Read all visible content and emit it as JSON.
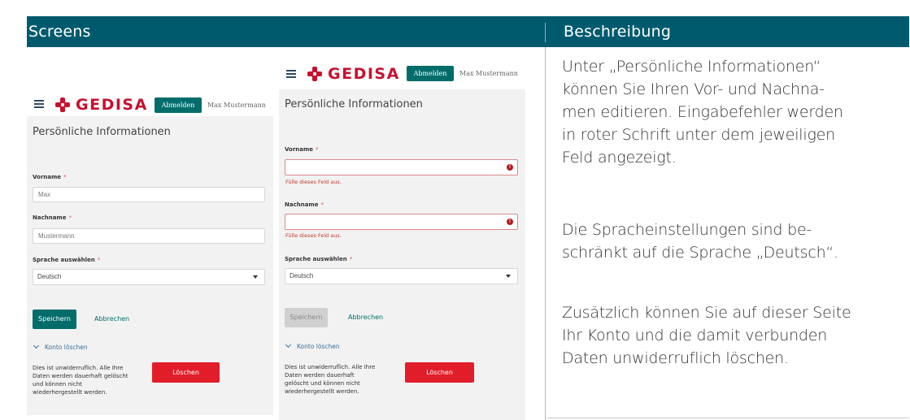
{
  "header": {
    "col_screens": "Screens",
    "col_description": "Beschreibung"
  },
  "screen1": {
    "brand": "GEDISA",
    "logout_label": "Abmelden",
    "user_name": "Max Mustermann",
    "page_title": "Persönliche Informationen",
    "first_name_label": "Vorname",
    "first_name_value": "Max",
    "last_name_label": "Nachname",
    "last_name_value": "Mustermann",
    "language_label": "Sprache auswählen",
    "language_value": "Deutsch",
    "required_mark": "*",
    "save_label": "Speichern",
    "cancel_label": "Abbrechen",
    "delete_account_label": "Konto löschen",
    "warning_lines": [
      "Dies ist unwiderruflich. Alle Ihre",
      "Daten werden dauerhaft gelöscht",
      "und können nicht",
      "wiederhergestellt werden."
    ],
    "delete_label": "Löschen"
  },
  "screen2": {
    "brand": "GEDISA",
    "logout_label": "Abmelden",
    "user_name": "Max Mustermann",
    "page_title": "Persönliche Informationen",
    "first_name_label": "Vorname",
    "first_name_value": "",
    "first_name_error": "Fülle dieses Feld aus.",
    "last_name_label": "Nachname",
    "last_name_value": "",
    "last_name_error": "Fülle dieses Feld aus.",
    "language_label": "Sprache auswählen",
    "language_value": "Deutsch",
    "required_mark": "*",
    "save_label": "Speichern",
    "cancel_label": "Abbrechen",
    "delete_account_label": "Konto löschen",
    "warning_lines": [
      "Dies ist unwiderruflich. Alle Ihre",
      "Daten werden dauerhaft",
      "gelöscht und können nicht",
      "wiederhergestellt werden."
    ],
    "delete_label": "Löschen",
    "error_icon": "!"
  },
  "description": {
    "p1": [
      "Unter „Persönliche Informationen“",
      "können Sie Ihren Vor- und Nachna-",
      "men editieren. Eingabefehler werden",
      "in roter Schrift unter dem jeweiligen",
      "Feld angezeigt."
    ],
    "p2": [
      "Die Spracheinstellungen sind be-",
      "schränkt auf die Sprache „Deutsch“."
    ],
    "p3": [
      "Zusätzlich können Sie auf dieser Seite",
      "Ihr Konto und die damit verbunden",
      "Daten unwiderruflich löschen."
    ]
  },
  "colors": {
    "header": "#005a6e",
    "brand_red": "#c8102e",
    "button_teal": "#006d6b",
    "delete_red": "#e21d2a",
    "error_red": "#c0392b"
  },
  "icons": {
    "menu": "hamburger-icon",
    "logo": "gedisa-cross-logo",
    "error": "error-icon",
    "chevron": "chevron-down-icon",
    "select": "caret-down-icon"
  }
}
